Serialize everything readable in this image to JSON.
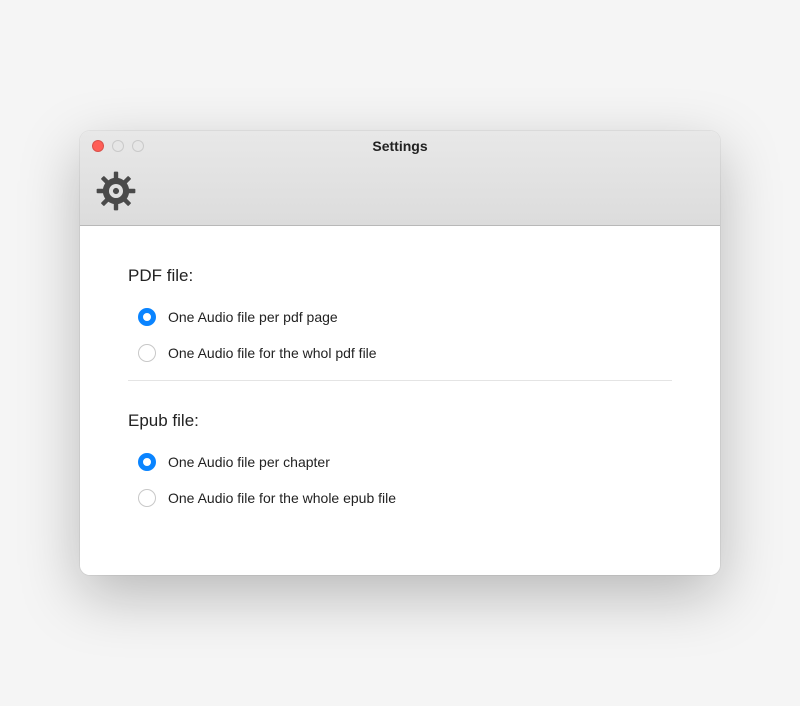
{
  "window": {
    "title": "Settings"
  },
  "sections": {
    "pdf": {
      "title": "PDF file:",
      "options": [
        {
          "label": "One Audio file per pdf page",
          "selected": true
        },
        {
          "label": "One Audio file for the whol pdf file",
          "selected": false
        }
      ]
    },
    "epub": {
      "title": "Epub file:",
      "options": [
        {
          "label": "One Audio file per chapter",
          "selected": true
        },
        {
          "label": "One Audio file for the whole epub file",
          "selected": false
        }
      ]
    }
  }
}
